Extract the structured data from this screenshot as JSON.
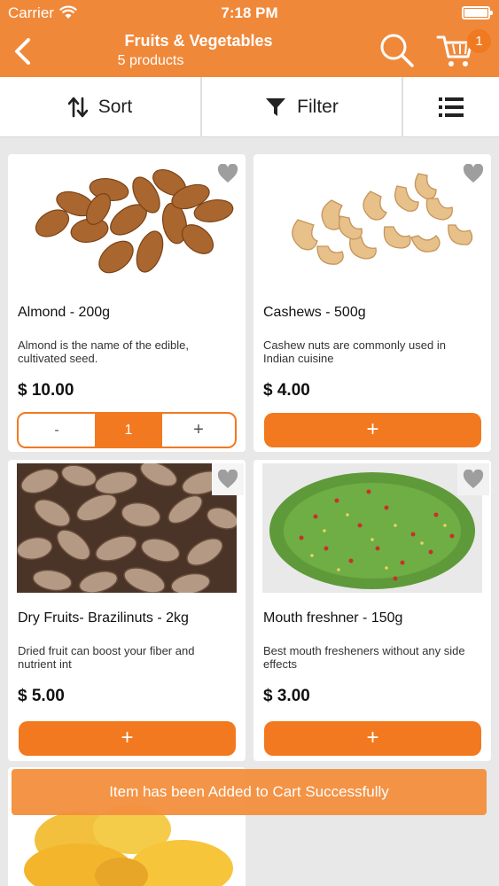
{
  "status_bar": {
    "carrier": "Carrier",
    "time": "7:18 PM"
  },
  "header": {
    "title": "Fruits & Vegetables",
    "subtitle": "5 products",
    "cart_count": "1"
  },
  "toolbar": {
    "sort_label": "Sort",
    "filter_label": "Filter"
  },
  "products": [
    {
      "name": "Almond - 200g",
      "description": "Almond is the name of the edible, cultivated seed.",
      "price": "$ 10.00",
      "quantity": "1",
      "minus": "-",
      "plus": "+"
    },
    {
      "name": "Cashews - 500g",
      "description": "Cashew nuts are commonly used in Indian cuisine",
      "price": "$ 4.00",
      "add": "+"
    },
    {
      "name": "Dry Fruits- Brazilinuts - 2kg",
      "description": "Dried fruit can boost your fiber and nutrient int",
      "price": "$ 5.00",
      "add": "+"
    },
    {
      "name": "Mouth freshner - 150g",
      "description": "Best mouth fresheners without any side effects",
      "price": "$ 3.00",
      "add": "+"
    }
  ],
  "toast": "Item has been Added to Cart Successfully",
  "colors": {
    "accent": "#f0883a",
    "button": "#f2791f",
    "background": "#e8e8e8"
  }
}
